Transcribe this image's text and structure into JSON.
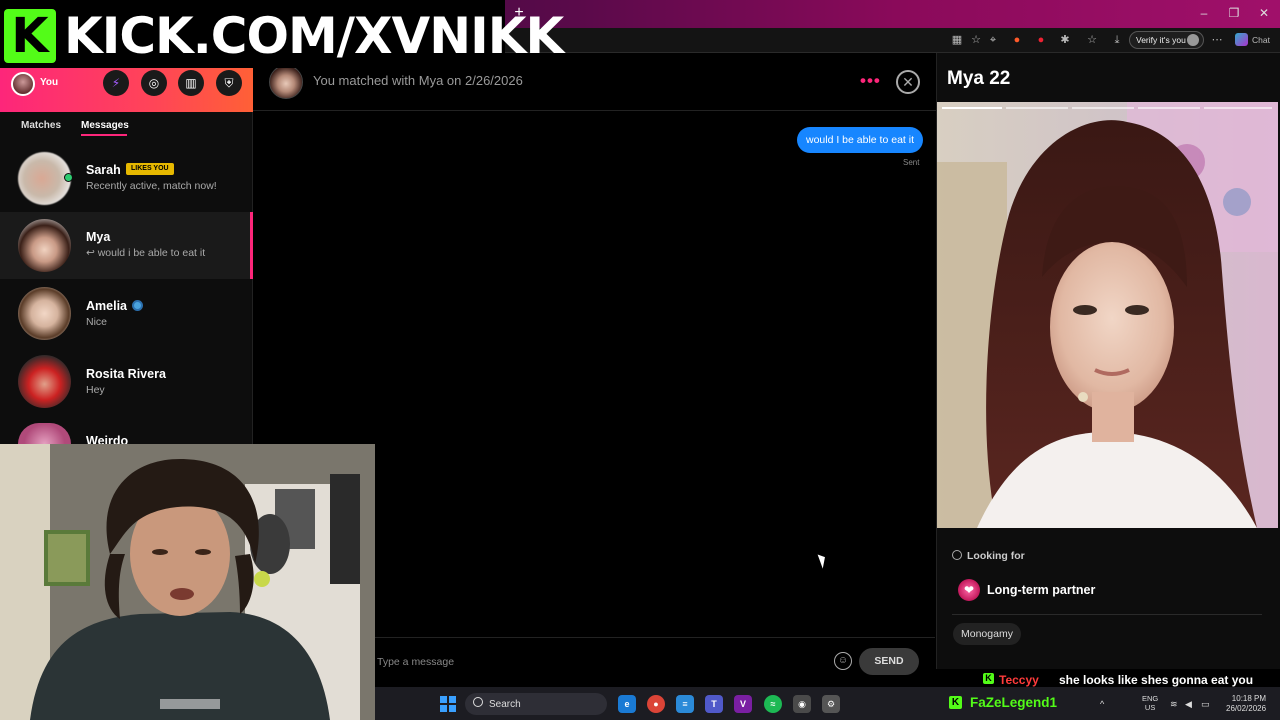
{
  "overlay": {
    "kick_logo": "K",
    "kick_text": "KICK.COM/XVNIKK"
  },
  "browser": {
    "new_tab": "+",
    "verify_label": "Verify it's you",
    "chat_label": "Chat",
    "window_controls": {
      "minimize": "–",
      "restore": "❐",
      "close": "✕"
    }
  },
  "sidebar": {
    "you_label": "You",
    "header_icons": [
      "boost-icon",
      "explore-icon",
      "gift-icon",
      "shield-icon"
    ],
    "tabs": {
      "matches": "Matches",
      "messages": "Messages"
    },
    "conversations": [
      {
        "name": "Sarah",
        "preview": "Recently active, match now!",
        "badge": "LIKES YOU",
        "online": true
      },
      {
        "name": "Mya",
        "preview": "↩ would i be able to eat it",
        "active": true
      },
      {
        "name": "Amelia",
        "preview": "Nice",
        "verified": true
      },
      {
        "name": "Rosita Rivera",
        "preview": "Hey"
      },
      {
        "name": "Weirdo",
        "preview": ""
      }
    ]
  },
  "chat": {
    "match_text": "You matched with Mya on 2/26/2026",
    "more_icon": "•••",
    "close_icon": "✕",
    "messages": [
      {
        "text": "would I be able to eat it",
        "status": "Sent",
        "from_me": true
      }
    ],
    "composer": {
      "placeholder": "Type a message",
      "emoji_icon": "☺",
      "send_label": "SEND"
    }
  },
  "profile": {
    "name_age": "Mya 22",
    "looking_for_label": "Looking for",
    "looking_for_value": "Long-term partner",
    "looking_for_icon": "❤",
    "tags": [
      "Monogamy"
    ],
    "photo_count": 5,
    "photo_index": 1
  },
  "stream_chat": {
    "user": "Teccyy",
    "message": "she looks like shes gonna eat you"
  },
  "taskbar": {
    "search_label": "Search",
    "kick_user": "FaZeLegend1",
    "lang_line1": "ENG",
    "lang_line2": "US",
    "time": "10:18 PM",
    "date": "26/02/2026",
    "apps": [
      "edge-icon",
      "chrome-icon",
      "notepad-icon",
      "teams-icon",
      "vegas-icon",
      "spotify-icon",
      "discord-icon",
      "settings-icon"
    ]
  },
  "colors": {
    "brand_pink": "#fd267a",
    "bubble_blue": "#1786ff",
    "kick_green": "#53fc18",
    "online_green": "#2ecc71",
    "badge_gold": "#e6b800"
  }
}
